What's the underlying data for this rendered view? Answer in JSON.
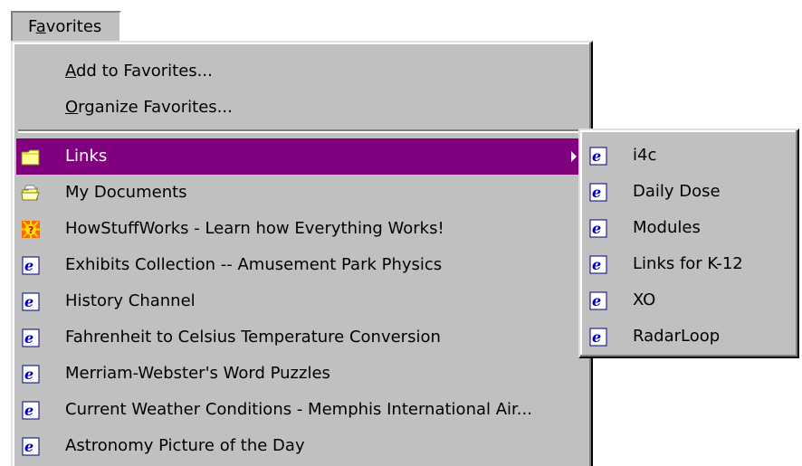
{
  "menubar": {
    "favorites_prefix": "F",
    "favorites_mnemonic": "a",
    "favorites_suffix": "vorites"
  },
  "menu": {
    "add_mnemonic": "A",
    "add_rest": "dd to Favorites...",
    "organize_mnemonic": "O",
    "organize_rest": "rganize Favorites...",
    "items": [
      {
        "label": "Links",
        "icon": "folder-icon"
      },
      {
        "label": "My Documents",
        "icon": "open-folder-icon"
      },
      {
        "label": "HowStuffWorks - Learn how Everything Works!",
        "icon": "sun-page-icon"
      },
      {
        "label": "Exhibits Collection -- Amusement Park Physics",
        "icon": "internet-explorer-icon"
      },
      {
        "label": "History Channel",
        "icon": "internet-explorer-icon"
      },
      {
        "label": "Fahrenheit to Celsius Temperature Conversion",
        "icon": "internet-explorer-icon"
      },
      {
        "label": "Merriam-Webster's Word Puzzles",
        "icon": "internet-explorer-icon"
      },
      {
        "label": "Current Weather Conditions - Memphis International Air...",
        "icon": "internet-explorer-icon"
      },
      {
        "label": "Astronomy Picture of the Day",
        "icon": "internet-explorer-icon"
      }
    ]
  },
  "submenu": {
    "items": [
      {
        "label": "i4c",
        "icon": "internet-explorer-icon"
      },
      {
        "label": "Daily Dose",
        "icon": "internet-explorer-icon"
      },
      {
        "label": "Modules",
        "icon": "internet-explorer-icon"
      },
      {
        "label": "Links for K-12",
        "icon": "internet-explorer-icon"
      },
      {
        "label": "XO",
        "icon": "internet-explorer-icon"
      },
      {
        "label": "RadarLoop",
        "icon": "internet-explorer-icon"
      }
    ]
  },
  "colors": {
    "menu_bg": "#c0c0c0",
    "highlight": "#800080",
    "highlight_text": "#ffffff"
  }
}
